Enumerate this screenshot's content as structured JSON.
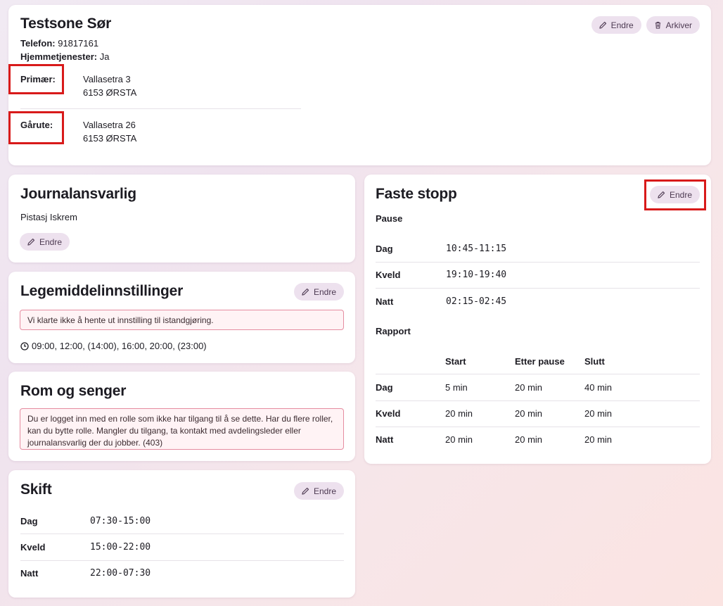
{
  "location": {
    "name": "Testsone Sør",
    "phone_label": "Telefon:",
    "phone": "91817161",
    "home_label": "Hjemmetjenester:",
    "home": "Ja",
    "edit_label": "Endre",
    "archive_label": "Arkiver",
    "addresses": [
      {
        "label": "Primær:",
        "line1": "Vallasetra 3",
        "line2": "6153 ØRSTA"
      },
      {
        "label": "Gårute:",
        "line1": "Vallasetra 26",
        "line2": "6153 ØRSTA"
      }
    ]
  },
  "journal": {
    "title": "Journalansvarlig",
    "person": "Pistasj Iskrem",
    "edit_label": "Endre"
  },
  "medication": {
    "title": "Legemiddelinnstillinger",
    "edit_label": "Endre",
    "error": "Vi klarte ikke å hente ut innstilling til istandgjøring.",
    "times": "09:00, 12:00, (14:00), 16:00, 20:00, (23:00)"
  },
  "rooms": {
    "title": "Rom og senger",
    "error": "Du er logget inn med en rolle som ikke har tilgang til å se dette. Har du flere roller, kan du bytte rolle. Mangler du tilgang, ta kontakt med avdelingsleder eller journalansvarlig der du jobber. (403)"
  },
  "shifts": {
    "title": "Skift",
    "edit_label": "Endre",
    "rows": [
      {
        "name": "Dag",
        "time": "07:30-15:00"
      },
      {
        "name": "Kveld",
        "time": "15:00-22:00"
      },
      {
        "name": "Natt",
        "time": "22:00-07:30"
      }
    ]
  },
  "fixed_stops": {
    "title": "Faste stopp",
    "edit_label": "Endre",
    "pause_heading": "Pause",
    "pause_rows": [
      {
        "name": "Dag",
        "time": "10:45-11:15"
      },
      {
        "name": "Kveld",
        "time": "19:10-19:40"
      },
      {
        "name": "Natt",
        "time": "02:15-02:45"
      }
    ],
    "report_heading": "Rapport",
    "report_columns": [
      "Start",
      "Etter pause",
      "Slutt"
    ],
    "report_rows": [
      {
        "name": "Dag",
        "start": "5 min",
        "after": "20 min",
        "end": "40 min"
      },
      {
        "name": "Kveld",
        "start": "20 min",
        "after": "20 min",
        "end": "20 min"
      },
      {
        "name": "Natt",
        "start": "20 min",
        "after": "20 min",
        "end": "20 min"
      }
    ]
  },
  "colors": {
    "accent_pill": "#ede1ee",
    "highlight_red": "#d81a1a",
    "error_border": "#e58ca0"
  }
}
